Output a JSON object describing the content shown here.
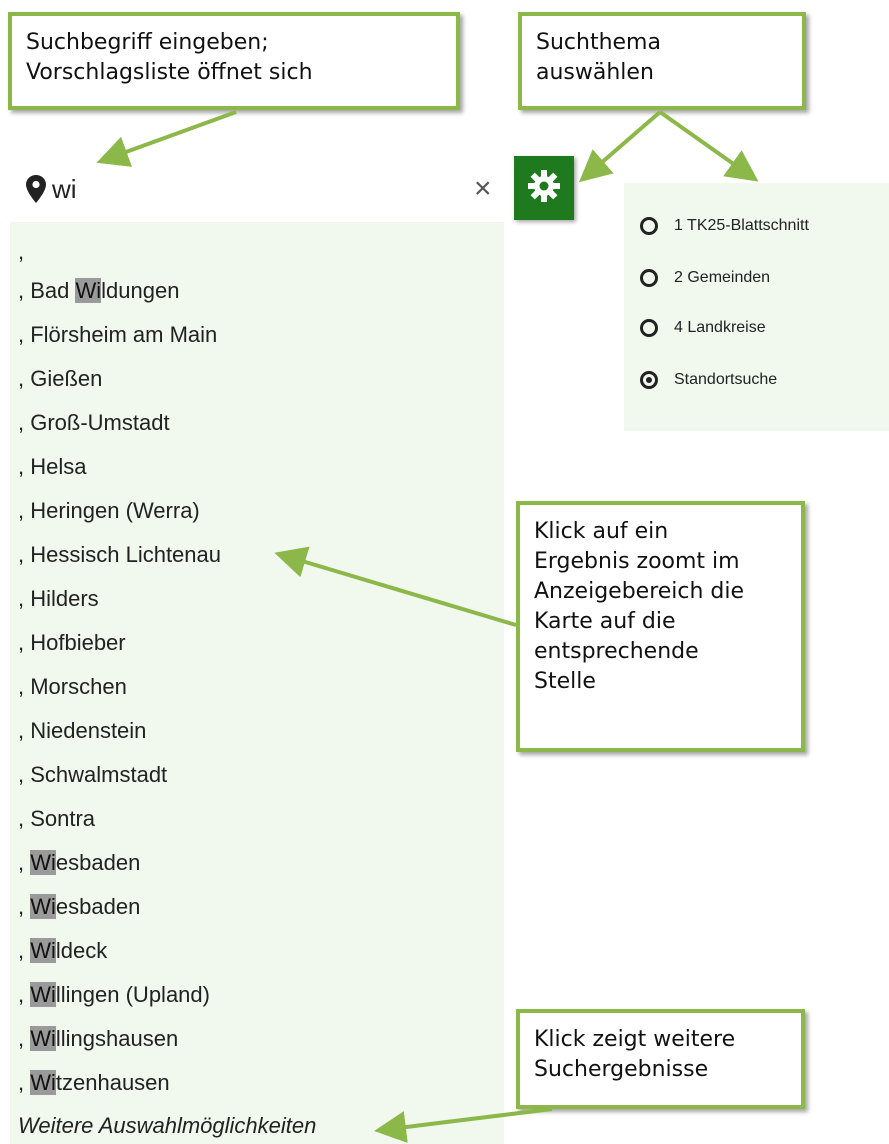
{
  "callouts": {
    "search_hint_line1": "Suchbegriff eingeben;",
    "search_hint_line2": "Vorschlagsliste öffnet sich",
    "theme_hint_line1": "Suchthema",
    "theme_hint_line2": "auswählen",
    "result_hint_lines": [
      "Klick auf ein",
      "Ergebnis zoomt im",
      "Anzeigebereich die",
      "Karte auf die",
      "entsprechende",
      "Stelle"
    ],
    "more_hint_line1": "Klick zeigt weitere",
    "more_hint_line2": "Suchergebnisse"
  },
  "search": {
    "value": "wi",
    "clear_icon": "close-icon",
    "settings_icon": "gear-icon",
    "accent_color": "#1f7a1f"
  },
  "results": [
    {
      "pre": ",",
      "hl": "",
      "post": ""
    },
    {
      "pre": ", Bad ",
      "hl": "Wi",
      "post": "ldungen"
    },
    {
      "pre": ", Flörsheim am Main",
      "hl": "",
      "post": ""
    },
    {
      "pre": ", Gießen",
      "hl": "",
      "post": ""
    },
    {
      "pre": ", Groß-Umstadt",
      "hl": "",
      "post": ""
    },
    {
      "pre": ", Helsa",
      "hl": "",
      "post": ""
    },
    {
      "pre": ", Heringen (Werra)",
      "hl": "",
      "post": ""
    },
    {
      "pre": ", Hessisch Lichtenau",
      "hl": "",
      "post": ""
    },
    {
      "pre": ", Hilders",
      "hl": "",
      "post": ""
    },
    {
      "pre": ", Hofbieber",
      "hl": "",
      "post": ""
    },
    {
      "pre": ", Morschen",
      "hl": "",
      "post": ""
    },
    {
      "pre": ", Niedenstein",
      "hl": "",
      "post": ""
    },
    {
      "pre": ", Schwalmstadt",
      "hl": "",
      "post": ""
    },
    {
      "pre": ", Sontra",
      "hl": "",
      "post": ""
    },
    {
      "pre": ", ",
      "hl": "Wi",
      "post": "esbaden"
    },
    {
      "pre": ", ",
      "hl": "Wi",
      "post": "esbaden"
    },
    {
      "pre": ", ",
      "hl": "Wi",
      "post": "ldeck"
    },
    {
      "pre": ", ",
      "hl": "Wi",
      "post": "llingen (Upland)"
    },
    {
      "pre": ", ",
      "hl": "Wi",
      "post": "llingshausen"
    },
    {
      "pre": ", ",
      "hl": "Wi",
      "post": "tzenhausen"
    }
  ],
  "more_results_label": "Weitere Auswahlmöglichkeiten",
  "themes": [
    {
      "label": "1 TK25-Blattschnitt",
      "selected": false
    },
    {
      "label": "2 Gemeinden",
      "selected": false
    },
    {
      "label": "4 Landkreise",
      "selected": false
    },
    {
      "label": "Standortsuche",
      "selected": true
    }
  ],
  "colors": {
    "callout_border": "#8cb84a",
    "highlight": "#9a9a9a",
    "panel_bg": "#f1f8ee"
  }
}
